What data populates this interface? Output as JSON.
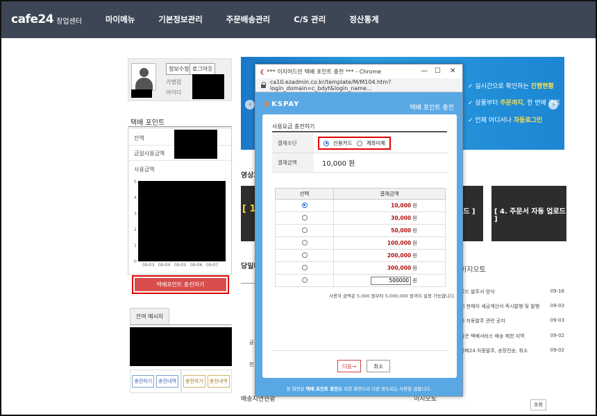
{
  "nav": {
    "logo": "cafe24",
    "logo_sub": "창업센터",
    "items": [
      "마이메뉴",
      "기본정보관리",
      "주문배송관리",
      "C/S 관리",
      "정산통계"
    ]
  },
  "profile": {
    "edit_label": "정보수정",
    "logout_label": "로그아웃",
    "store_label": "가맹점",
    "id_label": "아이디"
  },
  "points": {
    "title": "택배 포인트",
    "balance_label": "잔액",
    "today_used_label": "금일사용금액",
    "used_label": "사용금액",
    "y_ticks": [
      "5",
      "4",
      "3",
      "2",
      "1",
      "0"
    ],
    "x_ticks": [
      "09-03",
      "09-04",
      "09-05",
      "09-06",
      "09-07"
    ],
    "charge_button": "택배포인트 충전하기"
  },
  "message": {
    "tab": "잔여 메시지",
    "buttons": [
      "충전하기",
      "충전내역",
      "충전하기",
      "충전내역"
    ]
  },
  "banner": {
    "lines": [
      {
        "pre": "실시간으로 확인하는 ",
        "hl": "진행현황",
        "post": ""
      },
      {
        "pre": "상품부터 ",
        "hl": "주문까지",
        "post": ", 한 번에 관리"
      },
      {
        "pre": "언제 어디서나 ",
        "hl": "자동로그인",
        "post": ""
      }
    ]
  },
  "content": {
    "video_header": "영상가",
    "thumb_left": "[ 1",
    "thumb_mid": "로드 ]",
    "thumb_right": "[ 4. 주문서 자동 업로드 ]",
    "day_header": "당일배",
    "notice_header": "이지오토",
    "notices": [
      {
        "text": "로드 발주서 양식",
        "date": "09-16"
      },
      {
        "text": "회 판매자 세금계산서 즉시발행 및 발행",
        "date": "09-03"
      },
      {
        "text": "자 자동발주 관련 공지",
        "date": "09-03"
      },
      {
        "text": "좋은 택배서비스 배송 제한 지역",
        "date": "09-02"
      },
      {
        "text": "카페24 자동발주, 송장전송, 취소",
        "date": "09-02"
      }
    ],
    "bottom_left": "배송지연현황",
    "bottom_right": "이지오토",
    "lookup": "조회",
    "left_rows": [
      "금",
      "전"
    ]
  },
  "popup": {
    "window_title": "*** 이지어드민 택배 포인트 충전 *** - Chrome",
    "url": "ca10.ezadmin.co.kr/template/M/M104.htm?login_domain=c_bdyt&login_name...",
    "brand": "KSPAY",
    "title": "택배 포인트 충전",
    "section_title": "사용요금 충전하기",
    "method_label": "결제수단",
    "method_card": "신용카드",
    "method_transfer": "계좌이체",
    "amount_label": "결제금액",
    "amount_value": "10,000 원",
    "col_select": "선택",
    "col_amount": "결제금액",
    "options": [
      "10,000",
      "30,000",
      "50,000",
      "100,000",
      "200,000",
      "300,000"
    ],
    "won": "원",
    "custom_value": "500000",
    "note": "사용자 금액은 5,000 원부터 5,000,000 원까지 설정 가능합니다.",
    "next_button": "다음→",
    "cancel_button": "취소",
    "footer_pre": "본 화면은 ",
    "footer_bold": "택배 포인트 충전",
    "footer_post": "을 위한 화면으로 다른 용도로는 사용을 금합니다.",
    "colors": {
      "accent": "#5aa8e3",
      "highlight": "#e00000"
    }
  }
}
